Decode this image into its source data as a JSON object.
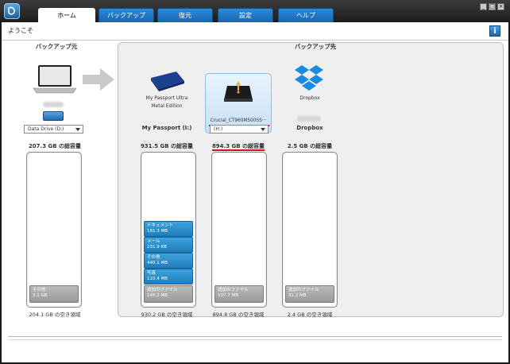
{
  "tabs": [
    {
      "label": "ホーム",
      "active": true
    },
    {
      "label": "バックアップ"
    },
    {
      "label": "復元"
    },
    {
      "label": "設定"
    },
    {
      "label": "ヘルプ"
    }
  ],
  "window_buttons": [
    "_",
    "□",
    "×"
  ],
  "welcome": "ようこそ",
  "info": "i",
  "source": {
    "heading": "バックアップ元",
    "drive_select": "Data Drive (D:)",
    "capacity": "207.3 GB の総容量",
    "segments": [
      {
        "label": "その他",
        "size": "3.1 GB"
      }
    ],
    "free": "204.1 GB の空き領域"
  },
  "destination": {
    "heading": "バックアップ先",
    "devices": [
      {
        "label_line1": "My Passport Ultra",
        "label_line2": "Metal Edition",
        "name": "My Passport (I:)",
        "capacity": "931.5 GB の総容量",
        "segments": [
          {
            "label": "ドキュメント",
            "size": "181.3 MB"
          },
          {
            "label": "メール",
            "size": "231.9 KB"
          },
          {
            "label": "その他",
            "size": "440.1 MB"
          },
          {
            "label": "写真",
            "size": "110.4 MB"
          },
          {
            "label": "追加のファイル",
            "size": "146.2 MB"
          }
        ],
        "free": "930.2 GB の空き領域"
      },
      {
        "label_line1": "Crucial_CT960M500SS···",
        "select": "(H:)",
        "capacity": "894.3 GB の総容量",
        "segments": [
          {
            "label": "追加のファイル",
            "size": "107.7 MB"
          }
        ],
        "free": "894.8 GB の空き領域"
      },
      {
        "label_line1": "Dropbox",
        "name": "Dropbox",
        "capacity": "2.5 GB の総容量",
        "segments": [
          {
            "label": "追加のファイル",
            "size": "31.2 MB"
          }
        ],
        "free": "2.4 GB の空き領域"
      }
    ]
  },
  "colors": {
    "accent": "#1f7cbd",
    "highlight": "#e01010",
    "tab": "#1666b2"
  }
}
